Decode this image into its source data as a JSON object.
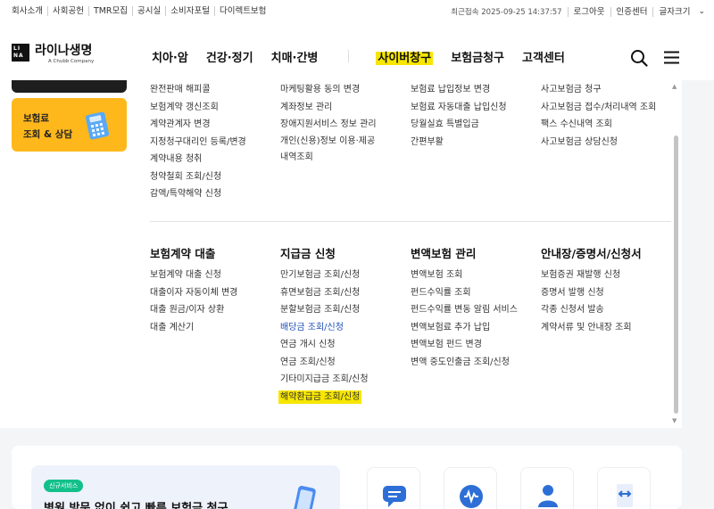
{
  "util": {
    "left_links": [
      "회사소개",
      "사회공헌",
      "TMR모집",
      "공시실",
      "소비자포털",
      "다이렉트보험"
    ],
    "last_login": "최근접속 2025-09-25 14:37:57",
    "right_links": [
      "로그아웃",
      "인증센터",
      "글자크기"
    ]
  },
  "header": {
    "logo_mark": "LI NA",
    "logo_name": "라이나생명",
    "logo_sub": "A Chubb Company",
    "nav": [
      "치아·암",
      "건강·정기",
      "치매·간병",
      "사이버창구",
      "보험금청구",
      "고객센터"
    ]
  },
  "left_cards": {
    "yellow_label_1": "보험료",
    "yellow_label_2": "조회 & 상담"
  },
  "menu_upper": {
    "col1": [
      "완전판매 해피콜",
      "보험계약 갱신조회",
      "계약관계자 변경",
      "지정청구대리인 등록/변경",
      "계약내용 청취",
      "청약철회 조회/신청",
      "감액/특약해약 신청"
    ],
    "col2": [
      "마케팅활용 동의 변경",
      "계좌정보 관리",
      "장애지원서비스 정보 관리",
      "개인(신용)정보 이용·제공 내역조회"
    ],
    "col3": [
      "보험료 납입정보 변경",
      "보험료 자동대출 납입신청",
      "당월실효 특별입금",
      "간편부활"
    ],
    "col4": [
      "사고보험금 청구",
      "사고보험금 접수/처리내역 조회",
      "팩스 수신내역 조회",
      "사고보험금 상담신청"
    ]
  },
  "menu_lower": {
    "sections": [
      {
        "title": "보험계약 대출",
        "items": [
          "보험계약 대출 신청",
          "대출이자 자동이체 변경",
          "대출 원금/이자 상환",
          "대출 계산기"
        ]
      },
      {
        "title": "지급금 신청",
        "items": [
          "만기보험금 조회/신청",
          "휴면보험금 조회/신청",
          "분할보험금 조회/신청",
          "배당금 조회/신청",
          "연금 개시 신청",
          "연금 조회/신청",
          "기타미지급금 조회/신청",
          "해약환급금 조회/신청"
        ]
      },
      {
        "title": "변액보험 관리",
        "items": [
          "변액보험 조회",
          "펀드수익률 조회",
          "펀드수익률 변동 알림 서비스",
          "변액보험료 추가 납입",
          "변액보험 펀드 변경",
          "변액 중도인출금 조회/신청"
        ]
      },
      {
        "title": "안내장/증명서/신청서",
        "items": [
          "보험증권 재발행 신청",
          "증명서 발행 신청",
          "각종 신청서 발송",
          "계약서류 및 안내장 조회"
        ]
      }
    ]
  },
  "bottom": {
    "badge": "신규서비스",
    "promo_title": "병원 방문 없이 쉽고 빠른 보험금 청구"
  },
  "colors": {
    "accent_yellow": "#f7e600",
    "card_yellow": "#ffb81c",
    "link_blue": "#1f4fb4"
  }
}
